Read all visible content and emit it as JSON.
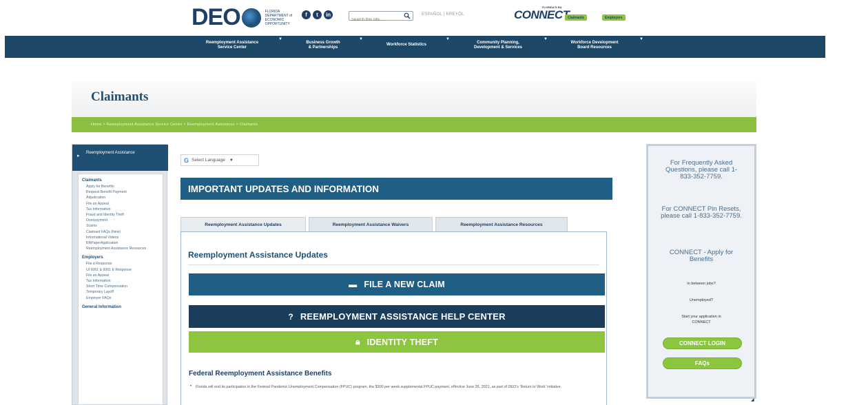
{
  "header": {
    "logo": "DEO",
    "logo_sub": [
      "FLORIDA",
      "DEPARTMENT of",
      "ECONOMIC",
      "OPPORTUNITY"
    ],
    "social": [
      {
        "icon": "facebook-icon",
        "glyph": "f"
      },
      {
        "icon": "twitter-icon",
        "glyph": "t"
      },
      {
        "icon": "linkedin-icon",
        "glyph": "in"
      }
    ],
    "search_placeholder": "Search this site...",
    "lang_links": "ESPAÑOL | KREYÒL",
    "connect_logo": "CONNECT",
    "connect_small": "FLORIDA'S RA",
    "claimants_pill": "Claimants",
    "employers_pill": "Employers"
  },
  "nav": [
    {
      "label": "Reemployment Assistance",
      "label2": "Service Center"
    },
    {
      "label": "Business Growth",
      "label2": "& Partnerships"
    },
    {
      "label": "Workforce Statistics",
      "label2": ""
    },
    {
      "label": "Community Planning,",
      "label2": "Development & Services"
    },
    {
      "label": "Workforce Development",
      "label2": "Board Resources"
    }
  ],
  "page_title": "Claimants",
  "breadcrumb": "Home  >  Reemployment Assistance Service Center  >  Reemployment Assistance  >  Claimants",
  "sidebar": {
    "heading": "Reemployment Assistance",
    "groups": [
      {
        "title": "Claimants",
        "items": [
          "Apply for Benefits",
          "Request Benefit Payment",
          "Adjudication",
          "File an Appeal",
          "Tax Information",
          "Fraud and Identity Theft",
          "Overpayment",
          "Scams",
          "Claimant FAQs (New)",
          "Informational Videos",
          "RAPaperApplication",
          "Reemployment Assistance Resources"
        ]
      },
      {
        "title": "Employers",
        "items": [
          "File a Response",
          "UI 6061 & 6061 E Response",
          "File an Appeal",
          "Tax Information",
          "Short Time Compensation",
          "Temporary Layoff",
          "Employer FAQs"
        ]
      },
      {
        "title": "General Information",
        "items": []
      }
    ]
  },
  "translate": {
    "label": "Select Language",
    "g": "G"
  },
  "banner": "IMPORTANT UPDATES AND INFORMATION",
  "tabs": [
    "Reemployment Assistance Updates",
    "Reemployment Assistance Waivers",
    "Reemployment Assistance Resources"
  ],
  "panel_title": "Reemployment Assistance Updates",
  "cta": {
    "file_claim": "FILE A NEW CLAIM",
    "help_center": "REEMPLOYMENT ASSISTANCE HELP CENTER",
    "identity_theft": "IDENTITY THEFT",
    "colors": {
      "file_claim": "#1f5f86",
      "help_center": "#1a3d5c",
      "identity_theft": "#8cc63e"
    }
  },
  "federal": {
    "title": "Federal Reemployment Assistance Benefits",
    "text": "Florida will end its participation in the Federal Pandemic Unemployment Compensation (FPUC) program, the $300 per week supplemental FPUC payment, effective June 26, 2021, as part of DEO's 'Return to Work' initiative."
  },
  "right_box": {
    "faq_call": "For Frequently Asked Questions, please call 1-833-352-7759.",
    "pin_reset": "For CONNECT Pin Resets, please call 1-833-352-7759.",
    "connect_apply": "CONNECT - Apply for Benefits",
    "between_jobs": "In between jobs?",
    "unemployed": "Unemployed?",
    "start_app": "Start your application in CONNECT",
    "login_btn": "CONNECT LOGIN",
    "faqs_btn": "FAQs"
  }
}
